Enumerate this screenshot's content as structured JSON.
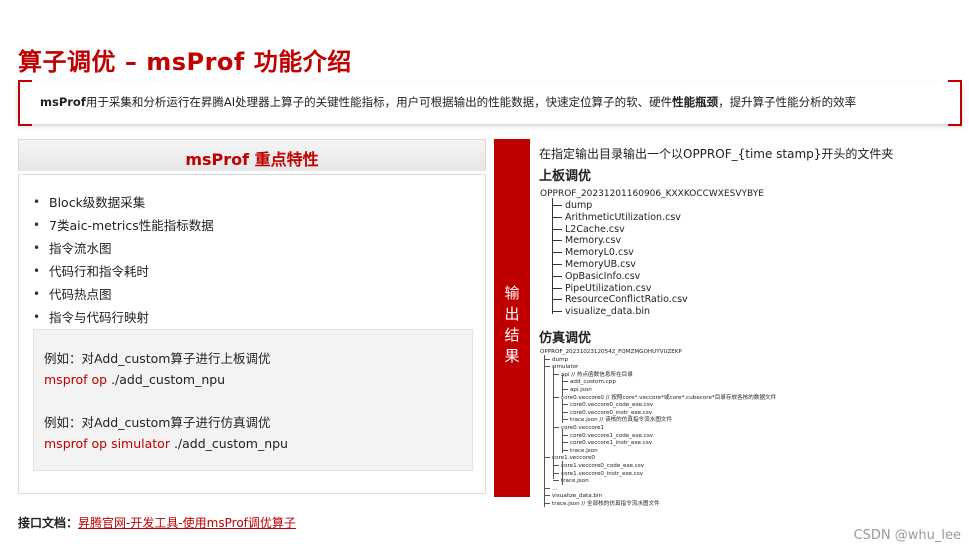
{
  "title": "算子调优 – msProf 功能介绍",
  "intro": {
    "lead": "msProf",
    "text_a": "用于采集和分析运行在昇腾AI处理器上算子的关键性能指标，用户可根据输出的性能数据，快速定位算子的软、硬件",
    "bold": "性能瓶颈",
    "text_b": "，提升算子性能分析的效率"
  },
  "features": {
    "heading": "msProf 重点特性",
    "items": [
      "Block级数据采集",
      "7类aic-metrics性能指标数据",
      "指令流水图",
      "代码行和指令耗时",
      "代码热点图",
      "指令与代码行映射"
    ],
    "examples": [
      {
        "desc": "例如：对Add_custom算子进行上板调优",
        "cmd": "msprof op",
        "args": " ./add_custom_npu"
      },
      {
        "desc": "例如：对Add_custom算子进行仿真调优",
        "cmd": "msprof op simulator",
        "args": " ./add_custom_npu"
      }
    ]
  },
  "output": {
    "label": "输出结果",
    "desc": "在指定输出目录输出一个以OPPROF_{time stamp}开头的文件夹",
    "board_title": "上板调优",
    "board_root": "OPPROF_20231201160906_KXXKOCCWXESVYBYE",
    "board_items": [
      "dump",
      "ArithmeticUtilization.csv",
      "L2Cache.csv",
      "Memory.csv",
      "MemoryL0.csv",
      "MemoryUB.csv",
      "OpBasicInfo.csv",
      "PipeUtilization.csv",
      "ResourceConflictRatio.csv",
      "visualize_data.bin"
    ],
    "sim_title": "仿真调优",
    "sim_lines": [
      "OPPROF_20231023120542_FQMZMGOHUYVUZEKP",
      "dump",
      "simulator",
      "api      // 热点函数信息所在目录",
      "add_custom.cpp",
      "api.json",
      "core0.veccore0      // 按照core*.veccore*或core*.cubecore*目录存放各核的数据文件",
      "core0.veccore0_code_exe.csv",
      "core0.veccore0_instr_exe.csv",
      "trace.json      // 该核的仿真指令流水图文件",
      "core0.veccore1",
      "core0.veccore1_code_exe.csv",
      "core0.veccore1_instr_exe.csv",
      "trace.json",
      "core1.veccore0",
      "core1.veccore0_code_exe.csv",
      "core1.veccore0_instr_exe.csv",
      "trace.json",
      "...",
      "visualize_data.bin",
      "trace.json      // 全部核的仿真指令流水图文件"
    ]
  },
  "footer": {
    "label": "接口文档：",
    "link": "昇腾官网-开发工具-使用msProf调优算子"
  },
  "watermark": "CSDN @whu_lee",
  "colors": {
    "accent": "#c00000"
  }
}
